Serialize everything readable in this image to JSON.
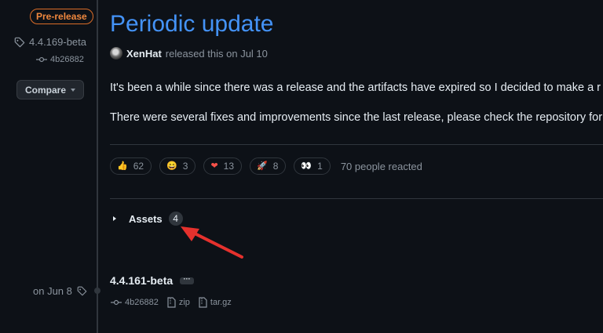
{
  "sidebar": {
    "prerelease_badge": "Pre-release",
    "tag": "4.4.169-beta",
    "commit": "4b26882",
    "compare_label": "Compare"
  },
  "release": {
    "title": "Periodic update",
    "author": "XenHat",
    "released_text": "released this on Jul 10",
    "para1": "It's been a while since there was a release and the artifacts have expired so I decided to make a r",
    "para2": "There were several fixes and improvements since the last release, please check the repository for",
    "reactions": [
      {
        "icon": "thumbs-up",
        "count": "62"
      },
      {
        "icon": "laugh",
        "count": "3"
      },
      {
        "icon": "heart",
        "count": "13"
      },
      {
        "icon": "rocket",
        "count": "8"
      },
      {
        "icon": "eyes",
        "count": "1"
      }
    ],
    "reacted_summary": "70 people reacted",
    "assets_label": "Assets",
    "assets_count": "4"
  },
  "previous_release": {
    "date": "on Jun 8",
    "tag": "4.4.161-beta",
    "ellipsis": "···",
    "commit": "4b26882",
    "zip_label": "zip",
    "targz_label": "tar.gz"
  },
  "colors": {
    "background": "#0d1117",
    "link": "#4493f8",
    "prerelease": "#f0883e",
    "annotation_arrow": "#e5312d"
  }
}
